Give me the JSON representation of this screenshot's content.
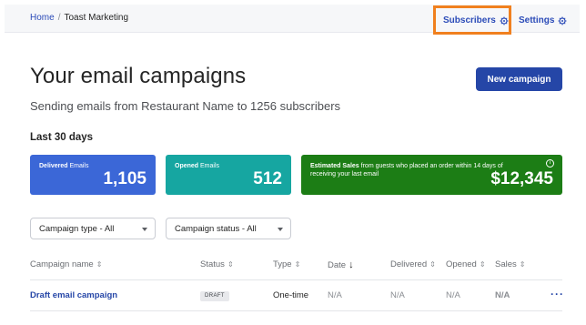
{
  "breadcrumb": {
    "home": "Home",
    "separator": "/",
    "current": "Toast Marketing"
  },
  "header": {
    "subscribers_label": "Subscribers",
    "settings_label": "Settings",
    "highlight_color": "#f0801e"
  },
  "page": {
    "title": "Your email campaigns",
    "subtitle": "Sending emails from Restaurant Name to 1256 subscribers",
    "new_campaign_label": "New campaign",
    "period_label": "Last 30 days"
  },
  "stats": {
    "delivered": {
      "label_strong": "Delivered",
      "label_rest": " Emails",
      "value": "1,105",
      "color": "#3b67d7"
    },
    "opened": {
      "label_strong": "Opened",
      "label_rest": " Emails",
      "value": "512",
      "color": "#16a6a1"
    },
    "sales": {
      "label_strong": "Estimated Sales",
      "label_rest": " from guests who placed an order within 14 days of receiving your last email",
      "value": "$12,345",
      "color": "#1c7d15",
      "info_icon": "info-icon"
    }
  },
  "filters": {
    "type": {
      "value": "Campaign type - All"
    },
    "status": {
      "value": "Campaign status - All"
    }
  },
  "table": {
    "columns": {
      "name": "Campaign name",
      "status": "Status",
      "type": "Type",
      "date": "Date",
      "delivered": "Delivered",
      "opened": "Opened",
      "sales": "Sales"
    },
    "rows": [
      {
        "name": "Draft email campaign",
        "status": "DRAFT",
        "type": "One-time",
        "date": "N/A",
        "delivered": "N/A",
        "opened": "N/A",
        "sales": "N/A",
        "menu": "···"
      }
    ]
  },
  "brand_color": "#2546a7"
}
